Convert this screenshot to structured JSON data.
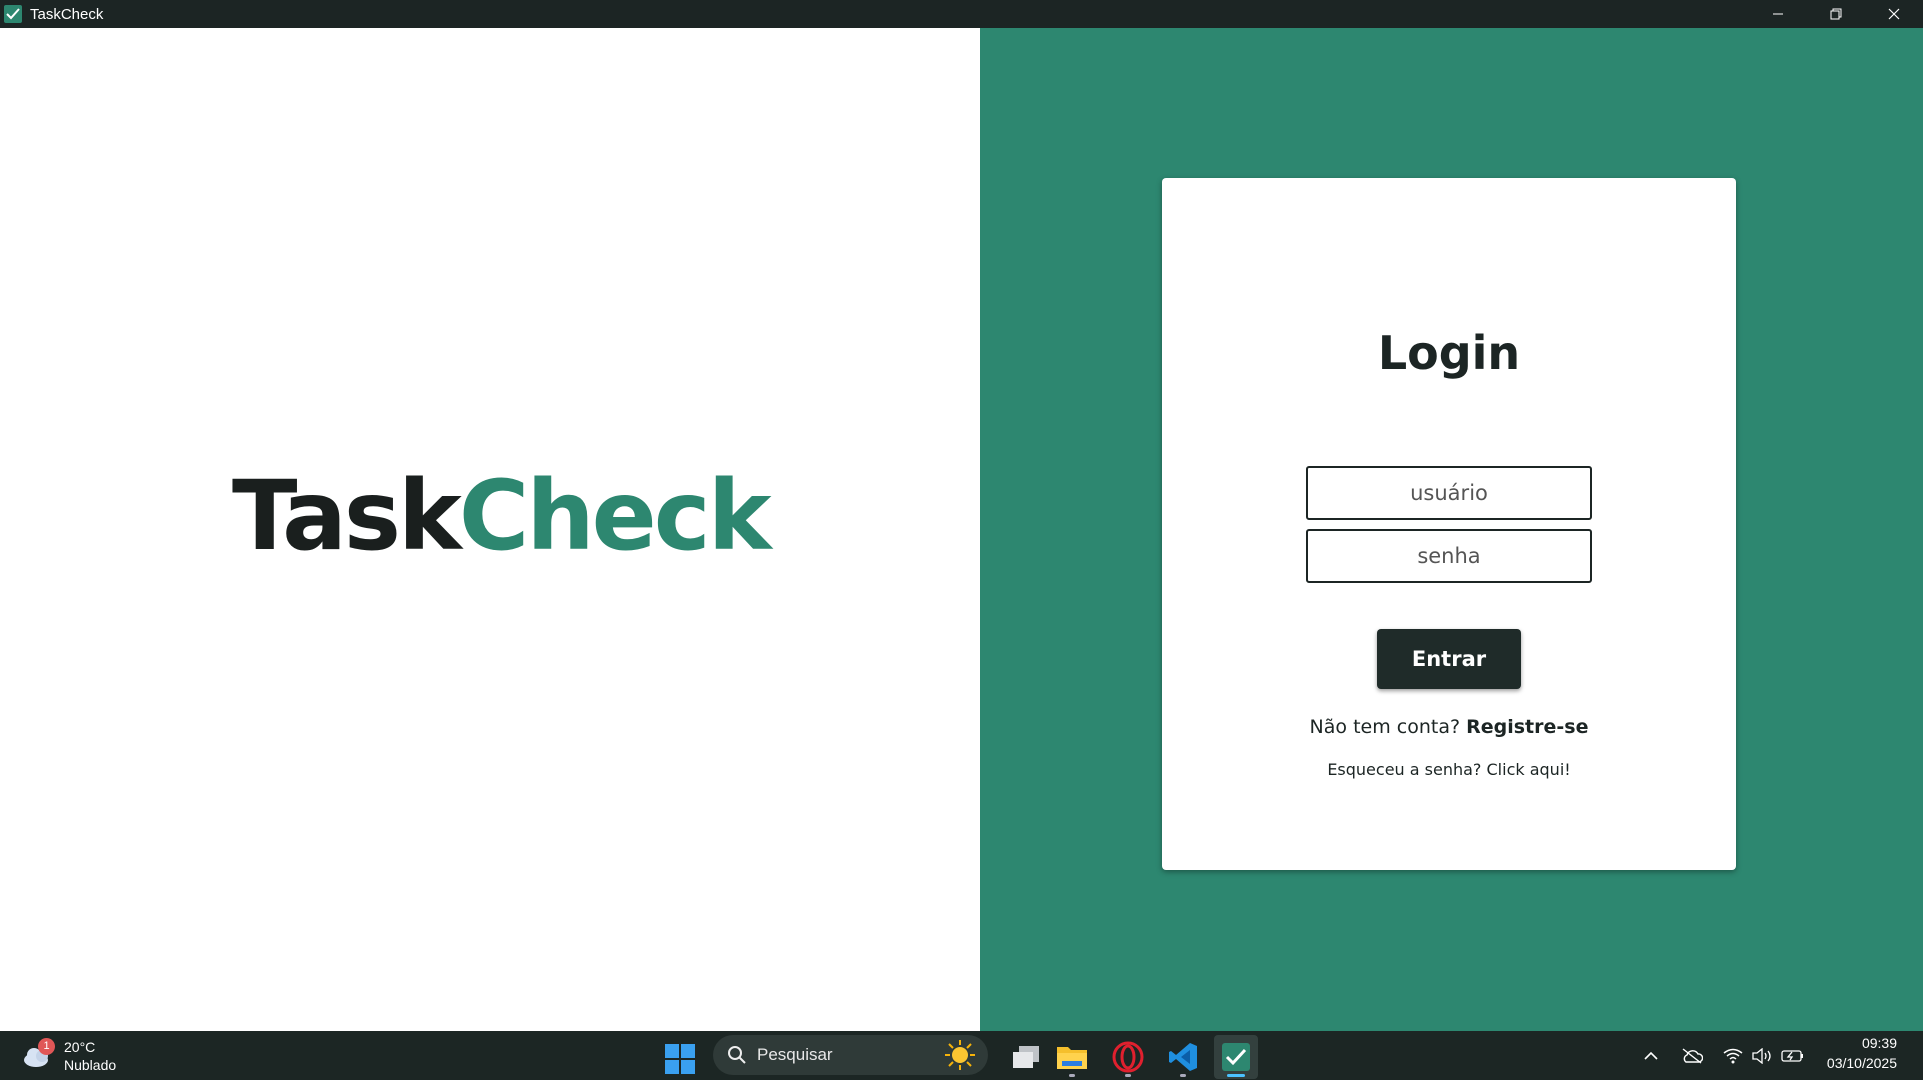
{
  "window": {
    "title": "TaskCheck",
    "minimize_icon": "minimize-icon",
    "restore_icon": "restore-icon",
    "close_icon": "close-icon"
  },
  "brand": {
    "part1": "Task",
    "part2": "Check",
    "colors": {
      "dark": "#1a1f1e",
      "accent": "#2d8770"
    }
  },
  "login": {
    "title": "Login",
    "username_placeholder": "usuário",
    "username_value": "",
    "password_placeholder": "senha",
    "password_value": "",
    "submit_label": "Entrar",
    "no_account_text": "Não tem conta?",
    "register_link": "Registre-se",
    "forgot_text": "Esqueceu a senha? Click aqui!"
  },
  "taskbar": {
    "weather": {
      "temperature": "20°C",
      "condition": "Nublado",
      "badge": "1",
      "icon": "cloud-icon"
    },
    "search": {
      "placeholder": "Pesquisar",
      "icon": "search-icon"
    },
    "apps": [
      {
        "name": "task-view",
        "icon": "task-view-icon"
      },
      {
        "name": "file-explorer",
        "icon": "folder-icon"
      },
      {
        "name": "opera",
        "icon": "opera-icon"
      },
      {
        "name": "vscode",
        "icon": "vscode-icon"
      },
      {
        "name": "taskcheck",
        "icon": "taskcheck-icon",
        "active": true
      }
    ],
    "clock": {
      "time": "09:39",
      "date": "03/10/2025"
    }
  }
}
